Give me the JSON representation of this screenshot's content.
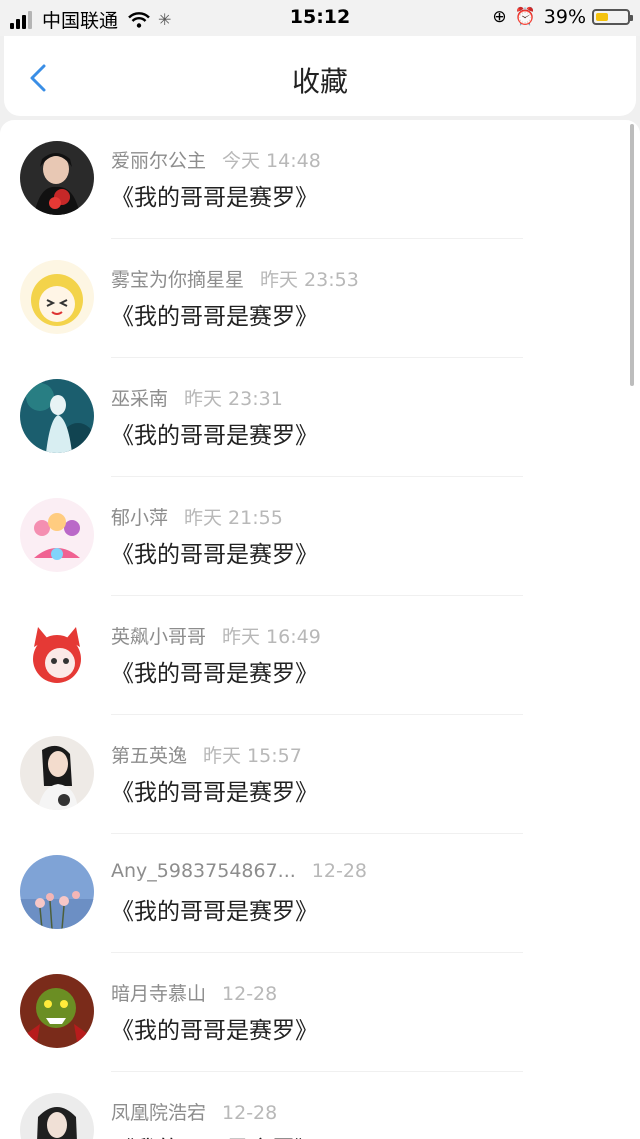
{
  "status_bar": {
    "carrier": "中国联通",
    "time": "15:12",
    "battery_percent": "39%",
    "battery_level": 0.39,
    "icons": [
      "signal-icon",
      "wifi-icon",
      "activity-icon",
      "orientation-lock-icon",
      "alarm-icon",
      "battery-icon"
    ]
  },
  "nav": {
    "back_icon": "chevron-left-icon",
    "title": "收藏",
    "accent_color": "#3a8ee6"
  },
  "favorites": [
    {
      "user": "爱丽尔公主",
      "time": "今天 14:48",
      "book": "《我的哥哥是赛罗》"
    },
    {
      "user": "雾宝为你摘星星",
      "time": "昨天 23:53",
      "book": "《我的哥哥是赛罗》"
    },
    {
      "user": "巫采南",
      "time": "昨天 23:31",
      "book": "《我的哥哥是赛罗》"
    },
    {
      "user": "郁小萍",
      "time": "昨天 21:55",
      "book": "《我的哥哥是赛罗》"
    },
    {
      "user": "英飙小哥哥",
      "time": "昨天 16:49",
      "book": "《我的哥哥是赛罗》"
    },
    {
      "user": "第五英逸",
      "time": "昨天 15:57",
      "book": "《我的哥哥是赛罗》"
    },
    {
      "user": "Any_5983754867...",
      "time": "12-28",
      "book": "《我的哥哥是赛罗》"
    },
    {
      "user": "暗月寺慕山",
      "time": "12-28",
      "book": "《我的哥哥是赛罗》"
    },
    {
      "user": "凤凰院浩宕",
      "time": "12-28",
      "book": "《我的哥哥是赛罗》"
    }
  ]
}
